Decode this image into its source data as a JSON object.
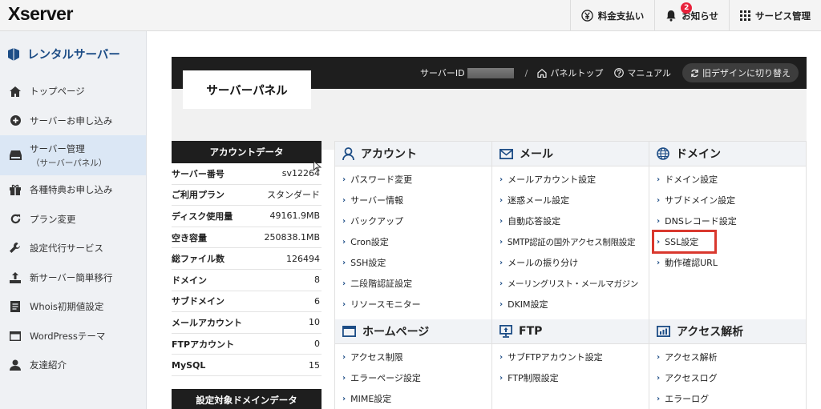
{
  "app": {
    "logo": "Xserver",
    "topnav": [
      {
        "label": "料金支払い",
        "icon": "yen-circle-icon"
      },
      {
        "label": "お知らせ",
        "icon": "bell-icon",
        "badge": "2"
      },
      {
        "label": "サービス管理",
        "icon": "grid-icon"
      }
    ]
  },
  "sidebar": {
    "title": "レンタルサーバー",
    "items": [
      {
        "label": "トップページ",
        "icon": "home-icon"
      },
      {
        "label": "サーバーお申し込み",
        "icon": "plus-circle-icon"
      },
      {
        "label": "サーバー管理",
        "sub": "（サーバーパネル）",
        "icon": "server-icon",
        "active": true
      },
      {
        "label": "各種特典お申し込み",
        "icon": "gift-icon"
      },
      {
        "label": "プラン変更",
        "icon": "refresh-icon"
      },
      {
        "label": "設定代行サービス",
        "icon": "wrench-icon"
      },
      {
        "label": "新サーバー簡単移行",
        "icon": "upload-icon"
      },
      {
        "label": "Whois初期値設定",
        "icon": "document-icon"
      },
      {
        "label": "WordPressテーマ",
        "icon": "window-icon"
      },
      {
        "label": "友達紹介",
        "icon": "user-icon"
      }
    ]
  },
  "panel": {
    "title": "サーバーパネル",
    "server_id_label": "サーバーID",
    "links": [
      "パネルトップ",
      "マニュアル"
    ],
    "old_design_button": "旧デザインに切り替え"
  },
  "account": {
    "title": "アカウントデータ",
    "rows": [
      {
        "k": "サーバー番号",
        "v": "sv12264"
      },
      {
        "k": "ご利用プラン",
        "v": "スタンダード"
      },
      {
        "k": "ディスク使用量",
        "v": "49161.9MB"
      },
      {
        "k": "空き容量",
        "v": "250838.1MB"
      },
      {
        "k": "総ファイル数",
        "v": "126494"
      },
      {
        "k": "ドメイン",
        "v": "8"
      },
      {
        "k": "サブドメイン",
        "v": "6"
      },
      {
        "k": "メールアカウント",
        "v": "10"
      },
      {
        "k": "FTPアカウント",
        "v": "0"
      },
      {
        "k": "MySQL",
        "v": "15"
      }
    ],
    "title2": "設定対象ドメインデータ"
  },
  "categories": {
    "account": {
      "title": "アカウント",
      "items": [
        "パスワード変更",
        "サーバー情報",
        "バックアップ",
        "Cron設定",
        "SSH設定",
        "二段階認証設定",
        "リソースモニター"
      ]
    },
    "mail": {
      "title": "メール",
      "items": [
        "メールアカウント設定",
        "迷惑メール設定",
        "自動応答設定",
        "SMTP認証の国外アクセス制限設定",
        "メールの振り分け",
        "メーリングリスト・メールマガジン",
        "DKIM設定"
      ]
    },
    "domain": {
      "title": "ドメイン",
      "items": [
        "ドメイン設定",
        "サブドメイン設定",
        "DNSレコード設定",
        "SSL設定",
        "動作確認URL"
      ]
    },
    "homepage": {
      "title": "ホームページ",
      "items": [
        "アクセス制限",
        "エラーページ設定",
        "MIME設定"
      ]
    },
    "ftp": {
      "title": "FTP",
      "items": [
        "サブFTPアカウント設定",
        "FTP制限設定"
      ]
    },
    "analytics": {
      "title": "アクセス解析",
      "items": [
        "アクセス解析",
        "アクセスログ",
        "エラーログ"
      ]
    }
  },
  "colors": {
    "accent": "#1d4d86",
    "highlight": "#d9382e",
    "badge": "#e8213b"
  }
}
